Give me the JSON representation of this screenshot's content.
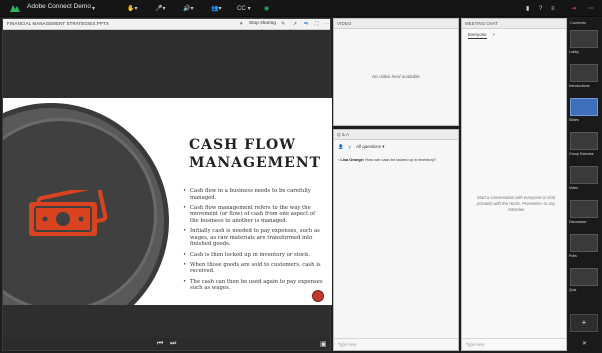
{
  "app": {
    "title": "Adobe Connect Demo"
  },
  "toolbar": {
    "cc_label": "CC"
  },
  "share_pod": {
    "title": "FINANCIAL MANAGEMENT STRATEGIES.PPTX",
    "stop_sharing": "Stop sharing"
  },
  "slide": {
    "title_line1": "CASH FLOW",
    "title_line2": "MANAGEMENT",
    "bullets": [
      "Cash flow in a business needs to be carefully managed.",
      "Cash flow management refers to the way the movement (or flow) of cash from one aspect of the business to another is managed.",
      "Initially cash is needed to pay expenses, such as wages, as raw materials are transformed into finished goods.",
      "Cash is then locked up in inventory or stock.",
      "When those goods are sold to customers, cash is received.",
      "The cash can then be used again to pay expenses such as wages."
    ]
  },
  "video_pod": {
    "title": "VIDEO",
    "no_feed": "No video feed available"
  },
  "qa_pod": {
    "title": "Q & A",
    "filter": "All questions",
    "question_author": "Lisa Orange:",
    "question_text": "How can cash be locked up in inventory?",
    "input_placeholder": "Type here"
  },
  "chat_pod": {
    "title": "MEETING CHAT",
    "tab_everyone": "Everyone",
    "add_tab": "+",
    "empty_text": "Start a conversation with everyone or chat privately with the Hosts, Presenters or any Attendee",
    "input_placeholder": "Type here"
  },
  "layouts": {
    "title": "Contents",
    "items": [
      "Lobby",
      "Introductions",
      "Slides",
      "Group Exercise",
      "Video",
      "Discussion",
      "Polls",
      "Quiz"
    ],
    "add": "+"
  }
}
